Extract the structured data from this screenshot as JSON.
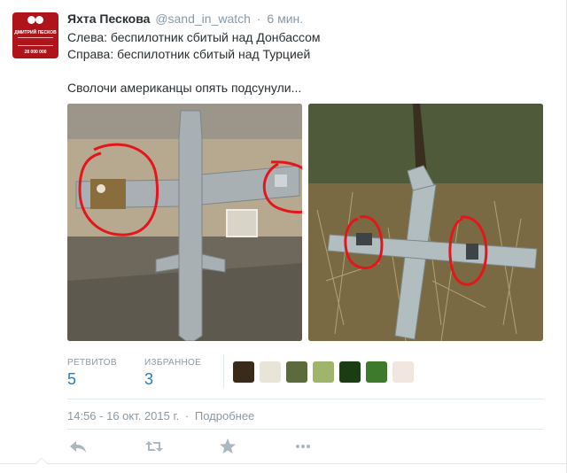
{
  "tweet": {
    "fullname": "Яхта Пескова",
    "username": "@sand_in_watch",
    "separator": "·",
    "time_ago": "6 мин.",
    "lines": [
      "Слева: беспилотник сбитый над Донбассом",
      "Справа: беспилотник сбитый над Турцией",
      "Сволочи американцы опять подсунули..."
    ],
    "avatar": {
      "name": "ДМИТРИЙ ПЕСКОВ",
      "count": "28 000 000"
    }
  },
  "photos": [
    {
      "name": "drone-donbass-photo"
    },
    {
      "name": "drone-turkey-photo"
    }
  ],
  "stats": {
    "retweets_label": "РЕТВИТОВ",
    "retweets_value": "5",
    "favorites_label": "ИЗБРАННОЕ",
    "favorites_value": "3",
    "faces": [
      {
        "color": "#3a2a1a"
      },
      {
        "color": "#e8e4d8"
      },
      {
        "color": "#5b6b3c"
      },
      {
        "color": "#9fb56b"
      },
      {
        "color": "#1b3d14"
      },
      {
        "color": "#3d7a2c"
      },
      {
        "color": "#f2e6e0"
      }
    ]
  },
  "meta": {
    "timestamp": "14:56 - 16 окт. 2015 г.",
    "separator": "·",
    "details_link": "Подробнее"
  },
  "actions": {
    "reply_icon": "reply-icon",
    "retweet_icon": "retweet-icon",
    "favorite_icon": "star-icon",
    "more_icon": "more-icon"
  },
  "colors": {
    "link": "#2b7bb9",
    "muted": "#8899a6",
    "text": "#292f33",
    "action_icon": "#aab8c2",
    "circle_marker": "#e4161b"
  }
}
